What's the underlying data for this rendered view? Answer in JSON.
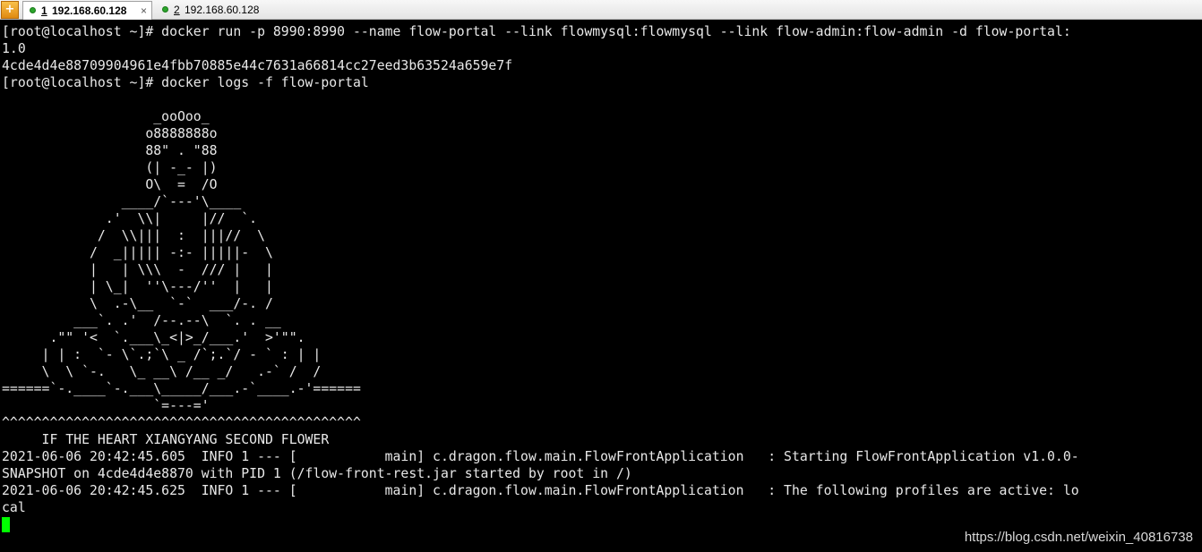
{
  "tabs": [
    {
      "number": "1",
      "host": "192.168.60.128",
      "close": "×"
    },
    {
      "number": "2",
      "host": "192.168.60.128"
    }
  ],
  "app_icon": "+",
  "terminal": {
    "lines": [
      "[root@localhost ~]# docker run -p 8990:8990 --name flow-portal --link flowmysql:flowmysql --link flow-admin:flow-admin -d flow-portal:",
      "1.0",
      "4cde4d4e88709904961e4fbb70885e44c7631a66814cc27eed3b63524a659e7f",
      "[root@localhost ~]# docker logs -f flow-portal",
      "",
      "                   _ooOoo_",
      "                  o8888888o",
      "                  88\" . \"88",
      "                  (| -_- |)",
      "                  O\\  =  /O",
      "               ____/`---'\\____",
      "             .'  \\\\|     |//  `.",
      "            /  \\\\|||  :  |||//  \\",
      "           /  _||||| -:- |||||-  \\",
      "           |   | \\\\\\  -  /// |   |",
      "           | \\_|  ''\\---/''  |   |",
      "           \\  .-\\__  `-`  ___/-. /",
      "         ___`. .'  /--.--\\  `. . __",
      "      .\"\" '<  `.___\\_<|>_/___.'  >'\"\".",
      "     | | :  `- \\`.;`\\ _ /`;.`/ - ` : | |",
      "     \\  \\ `-.   \\_ __\\ /__ _/   .-` /  /",
      "======`-.____`-.___\\_____/___.-`____.-'======",
      "                   `=---='",
      "^^^^^^^^^^^^^^^^^^^^^^^^^^^^^^^^^^^^^^^^^^^^^",
      "     IF THE HEART XIANGYANG SECOND FLOWER",
      "2021-06-06 20:42:45.605  INFO 1 --- [           main] c.dragon.flow.main.FlowFrontApplication   : Starting FlowFrontApplication v1.0.0-",
      "SNAPSHOT on 4cde4d4e8870 with PID 1 (/flow-front-rest.jar started by root in /)",
      "2021-06-06 20:42:45.625  INFO 1 --- [           main] c.dragon.flow.main.FlowFrontApplication   : The following profiles are active: lo",
      "cal"
    ],
    "cursor_color": "#00ff00"
  },
  "watermark": "https://blog.csdn.net/weixin_40816738"
}
